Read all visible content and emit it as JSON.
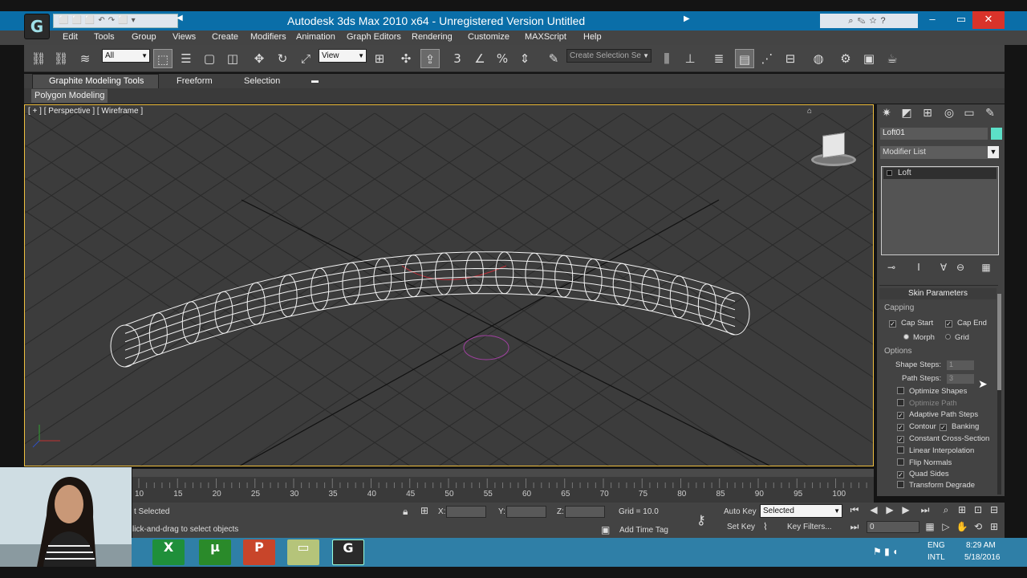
{
  "window": {
    "title": "Autodesk 3ds Max  2010 x64  - Unregistered Version     Untitled",
    "quick_access": "⬜⬜⬜↶↷⬜▾"
  },
  "menu": [
    "Edit",
    "Tools",
    "Group",
    "Views",
    "Create",
    "Modifiers",
    "Animation",
    "Graph Editors",
    "Rendering",
    "Customize",
    "MAXScript",
    "Help"
  ],
  "toolbar": {
    "filter": "All",
    "ref_coord": "View",
    "named_sel": "Create Selection Se",
    "snap3": "3",
    "percent": "%"
  },
  "ribbon": {
    "tabs": [
      "Graphite Modeling Tools",
      "Freeform",
      "Selection"
    ],
    "sub_tab": "Polygon Modeling"
  },
  "viewport": {
    "label": "[ + ] [ Perspective ] [ Wireframe ]"
  },
  "command_panel": {
    "object_name": "Loft01",
    "object_color": "#5ce0c8",
    "modifier_list": "Modifier List",
    "stack_item": "Loft",
    "rollout_title": "Skin Parameters",
    "capping_label": "Capping",
    "cap_start": "Cap Start",
    "cap_end": "Cap End",
    "morph": "Morph",
    "grid": "Grid",
    "options_label": "Options",
    "shape_steps_label": "Shape Steps:",
    "shape_steps": "1",
    "path_steps_label": "Path Steps:",
    "path_steps": "3",
    "optimize_shapes": "Optimize Shapes",
    "optimize_path": "Optimize Path",
    "adaptive_path_steps": "Adaptive Path Steps",
    "contour": "Contour",
    "banking": "Banking",
    "constant_cross_section": "Constant Cross-Section",
    "linear_interpolation": "Linear Interpolation",
    "flip_normals": "Flip Normals",
    "quad_sides": "Quad Sides",
    "transform_degrade": "Transform Degrade",
    "checked": {
      "cap_start": true,
      "cap_end": true,
      "adaptive_path_steps": true,
      "contour": true,
      "banking": true,
      "constant_cross_section": true,
      "quad_sides": true,
      "optimize_shapes": false,
      "optimize_path": false,
      "linear_interpolation": false,
      "flip_normals": false,
      "transform_degrade": false
    }
  },
  "timeline": {
    "ticks": [
      "10",
      "15",
      "20",
      "25",
      "30",
      "35",
      "40",
      "45",
      "50",
      "55",
      "60",
      "65",
      "70",
      "75",
      "80",
      "85",
      "90",
      "95",
      "100"
    ]
  },
  "status": {
    "selection": "t Selected",
    "prompt": "lick-and-drag to select objects",
    "x_label": "X:",
    "y_label": "Y:",
    "z_label": "Z:",
    "grid": "Grid = 10.0",
    "add_time_tag": "Add Time Tag",
    "auto_key": "Auto Key",
    "selected": "Selected",
    "set_key": "Set Key",
    "key_filters": "Key Filters...",
    "frame": "0"
  },
  "tray": {
    "lang1": "ENG",
    "lang2": "INTL",
    "time": "8:29 AM",
    "date": "5/18/2016"
  }
}
